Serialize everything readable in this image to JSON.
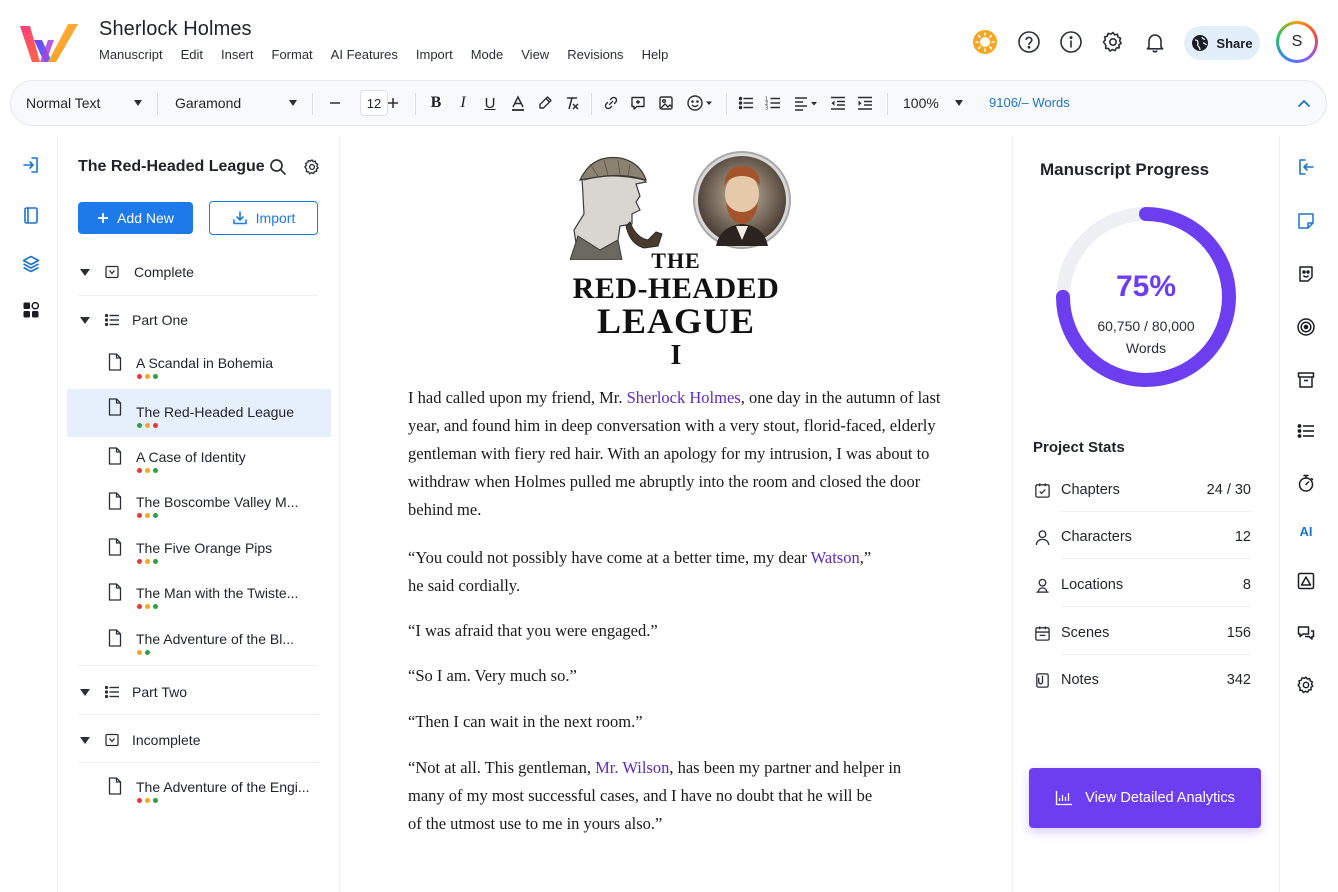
{
  "app": {
    "doc_title": "Sherlock Holmes",
    "menu": [
      "Manuscript",
      "Edit",
      "Insert",
      "Format",
      "AI Features",
      "Import",
      "Mode",
      "View",
      "Revisions",
      "Help"
    ],
    "share_label": "Share",
    "avatar_initial": "S",
    "colors": {
      "accent_blue": "#1e7ae8",
      "accent_purple": "#6d3df0",
      "sun": "#f5a623"
    }
  },
  "toolbar": {
    "style_value": "Normal Text",
    "font_value": "Garamond",
    "font_size": "12",
    "zoom_value": "100%",
    "word_count": "9106/– Words",
    "icons": [
      "bold-icon",
      "italic-icon",
      "underline-icon",
      "text-color-icon",
      "highlight-icon",
      "clear-format-icon",
      "link-icon",
      "comment-icon",
      "image-icon",
      "emoji-icon",
      "bullet-list-icon",
      "numbered-list-icon",
      "align-icon",
      "outdent-icon",
      "indent-icon",
      "collapse-icon"
    ]
  },
  "tree": {
    "title": "The Red-Headed League",
    "add_label": "Add New",
    "import_label": "Import",
    "groups": {
      "complete": "Complete",
      "part_one": "Part One",
      "part_two": "Part Two",
      "incomplete": "Incomplete"
    },
    "items": [
      {
        "label": "A Scandal in Bohemia",
        "dots": [
          "#e53935",
          "#f5a623",
          "#2e9e44"
        ]
      },
      {
        "label": "The Red-Headed League",
        "dots": [
          "#2e9e44",
          "#f5a623",
          "#e53935"
        ]
      },
      {
        "label": "A Case of Identity",
        "dots": [
          "#e53935",
          "#f5a623",
          "#2e9e44"
        ]
      },
      {
        "label": "The Boscombe Valley M...",
        "dots": [
          "#e53935",
          "#f5a623",
          "#2e9e44"
        ]
      },
      {
        "label": "The Five Orange Pips",
        "dots": [
          "#e53935",
          "#f5a623",
          "#2e9e44"
        ]
      },
      {
        "label": "The Man with the Twiste...",
        "dots": [
          "#e53935",
          "#f5a623",
          "#2e9e44"
        ]
      },
      {
        "label": "The Adventure of the Bl...",
        "dots": [
          "#f5a623",
          "#2e9e44"
        ]
      },
      {
        "label": "The Adventure of the Engi...",
        "dots": [
          "#e53935",
          "#f5a623",
          "#2e9e44"
        ]
      }
    ]
  },
  "editor": {
    "title_the": "THE",
    "title_line1": "RED-HEADED",
    "title_line2": "LEAGUE",
    "chapter_num": "I",
    "p1": {
      "a": "I had called upon my friend, Mr. ",
      "name": "Sherlock Holmes",
      "b": ", one day in the autumn of last year, and found him in deep conversation with a very stout, florid-faced, elderly gentleman with fiery red hair. With an apology for my intrusion, I was about to withdraw when Holmes pulled me abruptly into the room and closed the door behind me."
    },
    "p2": {
      "a": "“You could not possibly have come at a better time, my dear ",
      "name": "Watson",
      "b": ",”",
      "c": "he said cordially."
    },
    "p3": "“I was afraid that you were engaged.”",
    "p4": "“So I am. Very much so.”",
    "p5": "“Then I can wait in the next room.”",
    "p6": {
      "a": "“Not at all. This gentleman, ",
      "name": "Mr. Wilson",
      "b": ", has been my partner and helper in",
      "c": "many of my most successful cases, and I have no doubt that he will be",
      "d": "of the utmost use to me in yours also.”"
    }
  },
  "progress": {
    "title": "Manuscript Progress",
    "percent": "75%",
    "fraction": 0.75,
    "words": "60,750 / 80,000",
    "words_label": "Words",
    "stats_title": "Project Stats",
    "stats": [
      {
        "label": "Chapters",
        "value": "24 / 30",
        "icon": "calendar-icon"
      },
      {
        "label": "Characters",
        "value": "12",
        "icon": "person-icon"
      },
      {
        "label": "Locations",
        "value": "8",
        "icon": "location-person-icon"
      },
      {
        "label": "Scenes",
        "value": "156",
        "icon": "scene-icon"
      },
      {
        "label": "Notes",
        "value": "342",
        "icon": "notes-icon"
      }
    ],
    "analytics_label": "View Detailed Analytics"
  },
  "right_rail": {
    "ai_label": "AI"
  }
}
